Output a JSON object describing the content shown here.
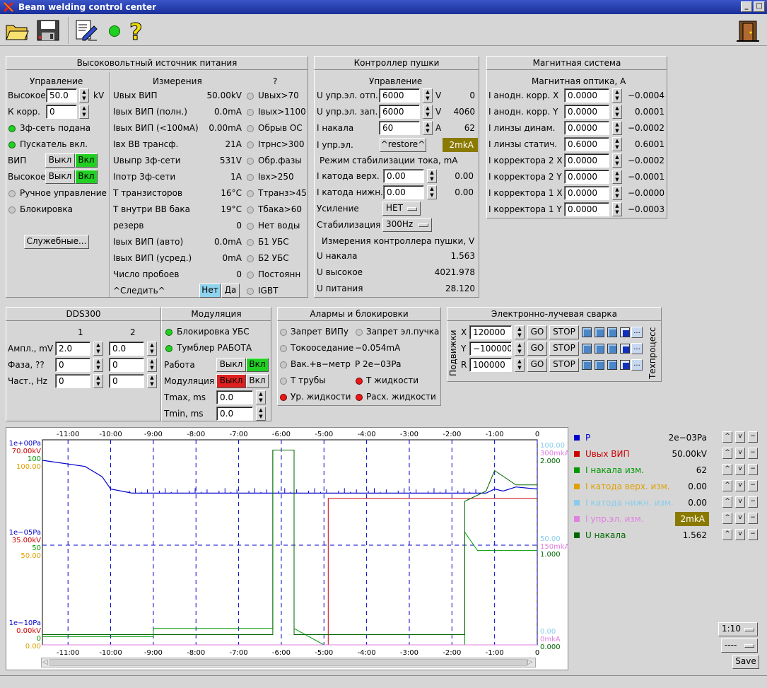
{
  "app": {
    "title": "Beam welding control center"
  },
  "colors": {
    "on": "#22d022",
    "led_green": "#20d020",
    "led_red": "#e81818",
    "olive": "#8a7a00",
    "blue": "#0000cc",
    "red": "#cc0000",
    "green": "#009900",
    "orange": "#e0a000",
    "cyan": "#88ccee",
    "pink": "#e080e0",
    "darkgreen": "#006600"
  },
  "toolbar": {
    "icons": [
      "open-folder-icon",
      "save-disk-icon",
      "edit-document-icon",
      "status-led-icon",
      "help-question-icon",
      "exit-door-icon"
    ]
  },
  "hv": {
    "title": "Высоковольтный источник питания",
    "control_title": "Управление",
    "meas_title": "Измерения",
    "q_title": "?",
    "ctrl": {
      "high_label": "Высокое",
      "high_value": "50.0",
      "high_unit": "kV",
      "kcorr_label": "К корр.",
      "kcorr_value": "0",
      "phase_label": "3ф-сеть подана",
      "starter_label": "Пускатель вкл.",
      "vip_label": "ВИП",
      "off": "Выкл",
      "on": "Вкл",
      "high2_label": "Высокое",
      "manual_label": "Ручное управление",
      "block_label": "Блокировка",
      "service_btn": "Служебные..."
    },
    "meas": [
      {
        "name": "Uвых ВИП",
        "value": "50.00kV"
      },
      {
        "name": "Iвых ВИП (полн.)",
        "value": "0.0mA"
      },
      {
        "name": "Iвых ВИП (<100мА)",
        "value": "0.00mA"
      },
      {
        "name": "Iвх ВВ трансф.",
        "value": "21A"
      },
      {
        "name": "Uвыпр 3ф-сети",
        "value": "531V"
      },
      {
        "name": "Iпотр 3ф-сети",
        "value": "1A"
      },
      {
        "name": "T транзисторов",
        "value": "16°C"
      },
      {
        "name": "T внутри ВВ бака",
        "value": "19°C"
      },
      {
        "name": "резерв",
        "value": "0"
      },
      {
        "name": "Iвых ВИП (авто)",
        "value": "0.0mA"
      },
      {
        "name": "Iвых ВИП (усред.)",
        "value": "0mA"
      },
      {
        "name": "Число пробоев",
        "value": "0"
      }
    ],
    "follow_label": "^Следить^",
    "no": "Нет",
    "yes": "Да",
    "flags": [
      "Uвых>70",
      "Iвых>1100",
      "Обрыв ОС",
      "Iтрнс>300",
      "Обр.фазы",
      "Iвх>250",
      "Tтранз>45",
      "Tбака>60",
      "Нет воды",
      "Б1 УБС",
      "Б2 УБС",
      "Постоянн",
      "IGBT"
    ]
  },
  "gun": {
    "title": "Контроллер пушки",
    "control_title": "Управление",
    "rows": [
      {
        "label": "U упр.эл. отп.",
        "value": "6000",
        "unit": "V",
        "read": "0"
      },
      {
        "label": "U упр.эл. зап.",
        "value": "6000",
        "unit": "V",
        "read": "4060"
      },
      {
        "label": "I накала",
        "value": "60",
        "unit": "A",
        "read": "62"
      }
    ],
    "iupr_label": "I упр.эл.",
    "restore_btn": "^restore^",
    "iupr_value": "2mkA",
    "stab_title": "Режим стабилизации тока, mA",
    "stab": [
      {
        "label": "I катода верх.",
        "value": "0.00",
        "read": "0.00"
      },
      {
        "label": "I катода нижн.",
        "value": "0.00",
        "read": "0.00"
      }
    ],
    "gain_label": "Усиление",
    "gain_value": "НЕТ",
    "stabil_label": "Стабилизация",
    "stabil_value": "300Hz",
    "meas_title": "Измерения контроллера пушки, V",
    "meas": [
      {
        "label": "U накала",
        "value": "1.563"
      },
      {
        "label": "U высокое",
        "value": "4021.978"
      },
      {
        "label": "U питания",
        "value": "28.120"
      }
    ]
  },
  "mag": {
    "title": "Магнитная система",
    "sub": "Магнитная оптика, А",
    "rows": [
      {
        "label": "I анодн. корр. X",
        "value": "0.0000",
        "read": "−0.0004"
      },
      {
        "label": "I анодн. корр. Y",
        "value": "0.0000",
        "read": "0.0001"
      },
      {
        "label": "I линзы динам.",
        "value": "0.0000",
        "read": "−0.0002"
      },
      {
        "label": "I линзы статич.",
        "value": "0.6000",
        "read": "0.6001"
      },
      {
        "label": "I корректора 2 X",
        "value": "0.0000",
        "read": "−0.0002"
      },
      {
        "label": "I корректора 2 Y",
        "value": "0.0000",
        "read": "−0.0001"
      },
      {
        "label": "I корректора 1 X",
        "value": "0.0000",
        "read": "−0.0000"
      },
      {
        "label": "I корректора 1 Y",
        "value": "0.0000",
        "read": "−0.0003"
      }
    ]
  },
  "dds": {
    "title": "DDS300",
    "col1": "1",
    "col2": "2",
    "rows": [
      {
        "label": "Ампл., mV",
        "v1": "2.0",
        "v2": "0.0"
      },
      {
        "label": "Фаза, ??",
        "v1": "0",
        "v2": "0"
      },
      {
        "label": "Част., Hz",
        "v1": "0",
        "v2": "0"
      }
    ]
  },
  "mod": {
    "title": "Модуляция",
    "ubs": "Блокировка УБС",
    "tumbler": "Тумблер РАБОТА",
    "work": "Работа",
    "modul": "Модуляция",
    "off": "Выкл",
    "on": "Вкл",
    "tmax_label": "Tmax, ms",
    "tmax": "0.0",
    "tmin_label": "Tmin, ms",
    "tmin": "0.0"
  },
  "alarms": {
    "title": "Алармы и блокировки",
    "a1": "Запрет ВИПу",
    "a2": "Запрет эл.пучка",
    "a3": "Токооседание",
    "a3v": "−0.054mA",
    "a4": "Вак.+в−метр",
    "a4v": "P 2e−03Pa",
    "a5": "T трубы",
    "a6": "T жидкости",
    "a7": "Ур. жидкости",
    "a8": "Расх. жидкости"
  },
  "ebw": {
    "title": "Электронно-лучевая сварка",
    "side": "Подвижки",
    "side2": "Техпроцесс",
    "axes": [
      {
        "name": "X",
        "value": "120000"
      },
      {
        "name": "Y",
        "value": "−100000"
      },
      {
        "name": "R",
        "value": "100000"
      }
    ],
    "go": "GO",
    "stop": "STOP",
    "more": "..."
  },
  "plot": {
    "left_labels": [
      {
        "t": "1e+00Pa",
        "c": "#0000cc"
      },
      {
        "t": "70.00kV",
        "c": "#cc0000"
      },
      {
        "t": "100",
        "c": "#009900"
      },
      {
        "t": "100.00",
        "c": "#e0a000"
      },
      {
        "t": "1e−05Pa",
        "c": "#0000cc"
      },
      {
        "t": "35.00kV",
        "c": "#cc0000"
      },
      {
        "t": "50",
        "c": "#009900"
      },
      {
        "t": "50.00",
        "c": "#e0a000"
      },
      {
        "t": "1e−10Pa",
        "c": "#0000cc"
      },
      {
        "t": "0.00kV",
        "c": "#cc0000"
      },
      {
        "t": "0",
        "c": "#009900"
      },
      {
        "t": "0.00",
        "c": "#e0a000"
      }
    ],
    "right_labels": [
      {
        "t": "100.00",
        "c": "#88ccee"
      },
      {
        "t": "300mkA",
        "c": "#e080e0"
      },
      {
        "t": "2.000",
        "c": "#006600"
      },
      {
        "t": "50.00",
        "c": "#88ccee"
      },
      {
        "t": "150mkA",
        "c": "#e080e0"
      },
      {
        "t": "1.000",
        "c": "#006600"
      },
      {
        "t": "0.00",
        "c": "#88ccee"
      },
      {
        "t": "0mkA",
        "c": "#e080e0"
      },
      {
        "t": "0.000",
        "c": "#006600"
      }
    ],
    "xticks": [
      "-11:00",
      "-10:00",
      "-9:00",
      "-8:00",
      "-7:00",
      "-6:00",
      "-5:00",
      "-4:00",
      "-3:00",
      "-2:00",
      "-1:00",
      "0"
    ],
    "legend": [
      {
        "name": "P",
        "value": "2e−03Pa",
        "color": "#0000cc"
      },
      {
        "name": "Uвых ВИП",
        "value": "50.00kV",
        "color": "#cc0000"
      },
      {
        "name": "I накала изм.",
        "value": "62",
        "color": "#009900"
      },
      {
        "name": "I катода верх. изм.",
        "value": "0.00",
        "color": "#e0a000"
      },
      {
        "name": "I катода нижн. изм.",
        "value": "0.00",
        "color": "#88ccee"
      },
      {
        "name": "I упр.эл. изм.",
        "value": "2mkA",
        "color": "#e080e0",
        "olive": true
      },
      {
        "name": "U накала",
        "value": "1.562",
        "color": "#006600"
      }
    ],
    "scale": "1:10",
    "mode": "----",
    "save": "Save"
  },
  "chart_data": {
    "type": "line",
    "xlabel": "",
    "ylabel": "",
    "xlim": [
      -11.5,
      0
    ],
    "x_ticks": [
      "-11:00",
      "-10:00",
      "-9:00",
      "-8:00",
      "-7:00",
      "-6:00",
      "-5:00",
      "-4:00",
      "-3:00",
      "-2:00",
      "-1:00",
      "0"
    ],
    "series": [
      {
        "name": "P",
        "color": "#0000cc",
        "x": [
          -11.6,
          -10.6,
          -10.2,
          -10.0,
          -9.5,
          -8,
          -7,
          -6.2,
          -6,
          -5,
          -4,
          -3,
          -2,
          -1.2,
          -1,
          -0.8,
          -0.5,
          0
        ],
        "y_log_pa": [
          -1,
          -1.3,
          -1.8,
          -2.4,
          -2.6,
          -2.6,
          -2.6,
          -2.6,
          -2.6,
          -2.6,
          -2.6,
          -2.6,
          -2.6,
          -2.6,
          -2.4,
          -2.5,
          -2.3,
          -2.4
        ]
      },
      {
        "name": "Uвых ВИП",
        "color": "#cc0000",
        "x": [
          -11.6,
          -4.9,
          -4.9,
          0
        ],
        "y_kv": [
          0,
          0,
          50,
          50
        ]
      },
      {
        "name": "I накала изм.",
        "color": "#009900",
        "x": [
          -11.6,
          -9.0,
          -9.0,
          -6.2,
          -6.2,
          -5.7,
          -5.7,
          -5,
          -1.7,
          -1.7,
          -1.4,
          0
        ],
        "y": [
          4,
          4,
          8,
          8,
          95,
          95,
          8,
          0,
          0,
          55,
          46,
          46
        ]
      },
      {
        "name": "I катода верх. изм.",
        "color": "#e0a000",
        "x": [
          -11.6,
          0
        ],
        "y": [
          0,
          0
        ]
      },
      {
        "name": "I катода нижн. изм.",
        "color": "#88ccee",
        "x": [
          -11.6,
          0
        ],
        "y": [
          0,
          0
        ]
      },
      {
        "name": "I упр.эл. изм.",
        "color": "#e080e0",
        "x": [
          -11.6,
          0
        ],
        "y": [
          0,
          0
        ]
      },
      {
        "name": "U накала",
        "color": "#006600",
        "x": [
          -11.6,
          -6.2,
          -6.2,
          -5.7,
          -5.7,
          -1.7,
          -1.7,
          -1.2,
          -1.0,
          -0.5,
          0
        ],
        "y": [
          0.1,
          0.1,
          1.9,
          1.9,
          0.1,
          0.1,
          1.4,
          1.5,
          1.7,
          1.56,
          1.56
        ]
      }
    ]
  }
}
